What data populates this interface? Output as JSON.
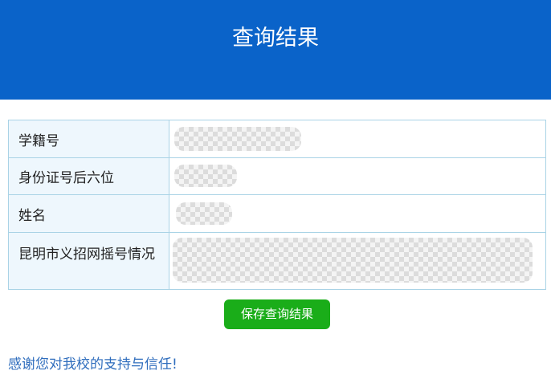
{
  "header": {
    "title": "查询结果",
    "background_color": "#0a63c9"
  },
  "result_table": {
    "rows": [
      {
        "label": "学籍号",
        "value": ""
      },
      {
        "label": "身份证号后六位",
        "value": ""
      },
      {
        "label": "姓名",
        "value": ""
      },
      {
        "label": "昆明市义招网摇号情况",
        "value": ""
      }
    ],
    "label_background": "#eef7fd",
    "border_color": "#a9d3e6"
  },
  "actions": {
    "save_label": "保存查询结果",
    "save_color": "#1aad19"
  },
  "footer": {
    "thanks_text": "感谢您对我校的支持与信任!",
    "thanks_color": "#2f6dbd"
  }
}
